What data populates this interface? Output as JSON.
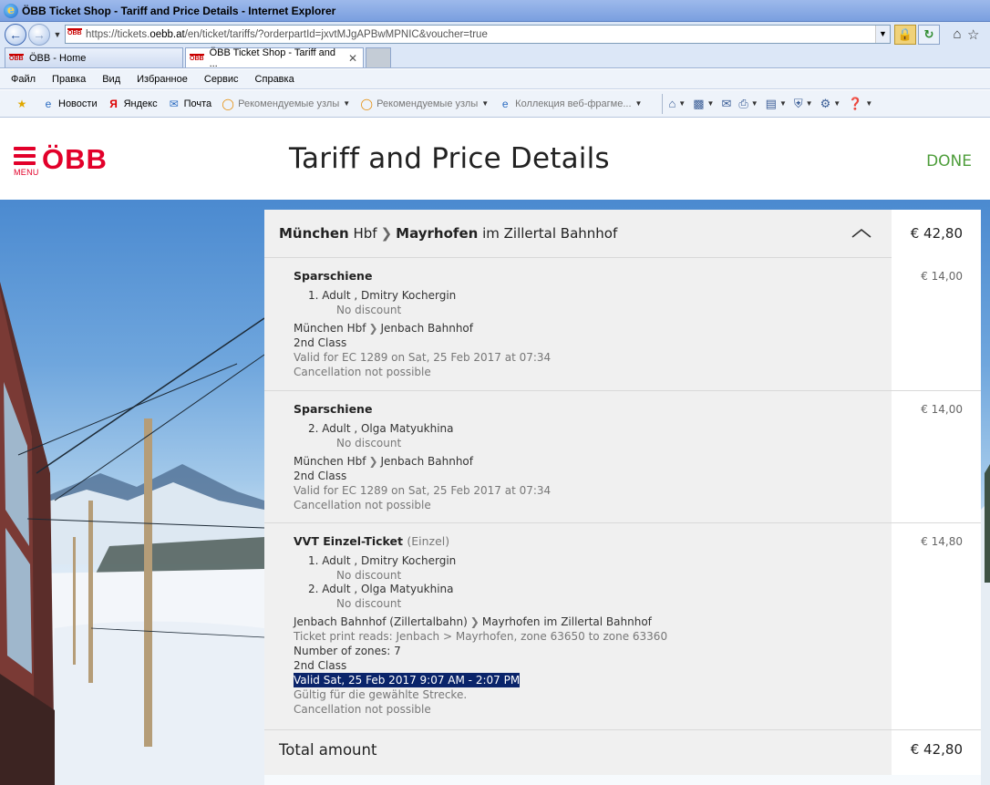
{
  "browser": {
    "window_title": "ÖBB Ticket Shop - Tariff and Price Details - Internet Explorer",
    "url_prefix": "https://tickets.",
    "url_host": "oebb.at",
    "url_path": "/en/ticket/tariffs/?orderpartId=jxvtMJgAPBwMPNIC&voucher=true",
    "tabs": [
      {
        "label": "ÖBB - Home",
        "active": false
      },
      {
        "label": "ÖBB Ticket Shop - Tariff and ...",
        "active": true
      }
    ],
    "menu": [
      "Файл",
      "Правка",
      "Вид",
      "Избранное",
      "Сервис",
      "Справка"
    ],
    "favorites": [
      {
        "label": "Новости",
        "icon": "page-icon"
      },
      {
        "label": "Яндекс",
        "icon": "yandex-icon"
      },
      {
        "label": "Почта",
        "icon": "mail-icon"
      },
      {
        "label": "Рекомендуемые узлы",
        "icon": "suggested-sites-icon"
      },
      {
        "label": "Рекомендуемые узлы",
        "icon": "suggested-sites-icon"
      },
      {
        "label": "Коллекция веб-фрагме...",
        "icon": "web-slice-icon"
      }
    ]
  },
  "header": {
    "menu_label": "MENU",
    "logo": "ÖBB",
    "title": "Tariff and Price Details",
    "done_label": "DONE"
  },
  "route": {
    "from_bold": "München",
    "from_rest": "Hbf",
    "to_bold": "Mayrhofen",
    "to_rest": "im Zillertal Bahnhof",
    "price": "€ 42,80"
  },
  "tickets": [
    {
      "name": "Sparschiene",
      "price": "€ 14,00",
      "passengers": [
        {
          "line": "1. Adult , Dmitry Kochergin",
          "discount": "No discount"
        }
      ],
      "segment_from": "München Hbf",
      "segment_to": "Jenbach Bahnhof",
      "class": "2nd Class",
      "validity": "Valid for EC 1289 on Sat, 25 Feb 2017 at 07:34",
      "cancellation": "Cancellation not possible"
    },
    {
      "name": "Sparschiene",
      "price": "€ 14,00",
      "passengers": [
        {
          "line": "2. Adult , Olga Matyukhina",
          "discount": "No discount"
        }
      ],
      "segment_from": "München Hbf",
      "segment_to": "Jenbach Bahnhof",
      "class": "2nd Class",
      "validity": "Valid for EC 1289 on Sat, 25 Feb 2017 at 07:34",
      "cancellation": "Cancellation not possible"
    },
    {
      "name": "VVT Einzel-Ticket",
      "name_suffix": "(Einzel)",
      "price": "€ 14,80",
      "passengers": [
        {
          "line": "1. Adult , Dmitry Kochergin",
          "discount": "No discount"
        },
        {
          "line": "2. Adult , Olga Matyukhina",
          "discount": "No discount"
        }
      ],
      "segment_from": "Jenbach Bahnhof (Zillertalbahn)",
      "segment_to": "Mayrhofen im Zillertal Bahnhof",
      "print_reads": "Ticket print reads: Jenbach > Mayrhofen, zone 63650 to zone 63360",
      "zones": "Number of zones: 7",
      "class": "2nd Class",
      "validity": "Valid Sat, 25 Feb 2017 9:07 AM - 2:07 PM",
      "note": "Gültig für die gewählte Strecke.",
      "cancellation": "Cancellation not possible"
    }
  ],
  "total": {
    "label": "Total amount",
    "value": "€ 42,80"
  },
  "colors": {
    "brand_red": "#e2002a",
    "done_green": "#4d9d3a",
    "selection": "#0a246a"
  }
}
